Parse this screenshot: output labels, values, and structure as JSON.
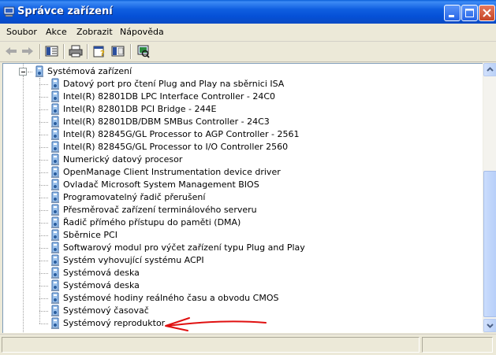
{
  "window": {
    "title": "Správce zařízení"
  },
  "menu": [
    "Soubor",
    "Akce",
    "Zobrazit",
    "Nápověda"
  ],
  "toolbar": {
    "icons": [
      "back-icon",
      "forward-icon",
      "show-hide-console-tree-icon",
      "print-icon",
      "properties-icon",
      "help-icon",
      "scan-hardware-icon"
    ]
  },
  "tree": {
    "category": "Systémová zařízení",
    "devices": [
      "Datový port pro čtení Plug and Play na sběrnici ISA",
      "Intel(R) 82801DB LPC Interface Controller - 24C0",
      "Intel(R) 82801DB PCI Bridge - 244E",
      "Intel(R) 82801DB/DBM SMBus Controller - 24C3",
      "Intel(R) 82845G/GL Processor to AGP Controller - 2561",
      "Intel(R) 82845G/GL Processor to I/O Controller 2560",
      "Numerický datový procesor",
      "OpenManage Client Instrumentation device driver",
      "Ovladač Microsoft System Management BIOS",
      "Programovatelný řadič přerušení",
      "Přesměrovač zařízení terminálového serveru",
      "Řadič přímého přístupu do paměti (DMA)",
      "Sběrnice PCI",
      "Softwarový modul pro výčet zařízení typu Plug and Play",
      "Systém vyhovující systému ACPI",
      "Systémová deska",
      "Systémová deska",
      "Systémové hodiny reálného času a obvodu CMOS",
      "Systémový časovač",
      "Systémový reproduktor"
    ]
  },
  "annotation": {
    "color": "#e01010",
    "points_to": "Systémový reproduktor"
  },
  "colors": {
    "titlebar": "#0a5fd8",
    "window_bg": "#ece9d8",
    "tree_lines": "#a0a0a0"
  }
}
